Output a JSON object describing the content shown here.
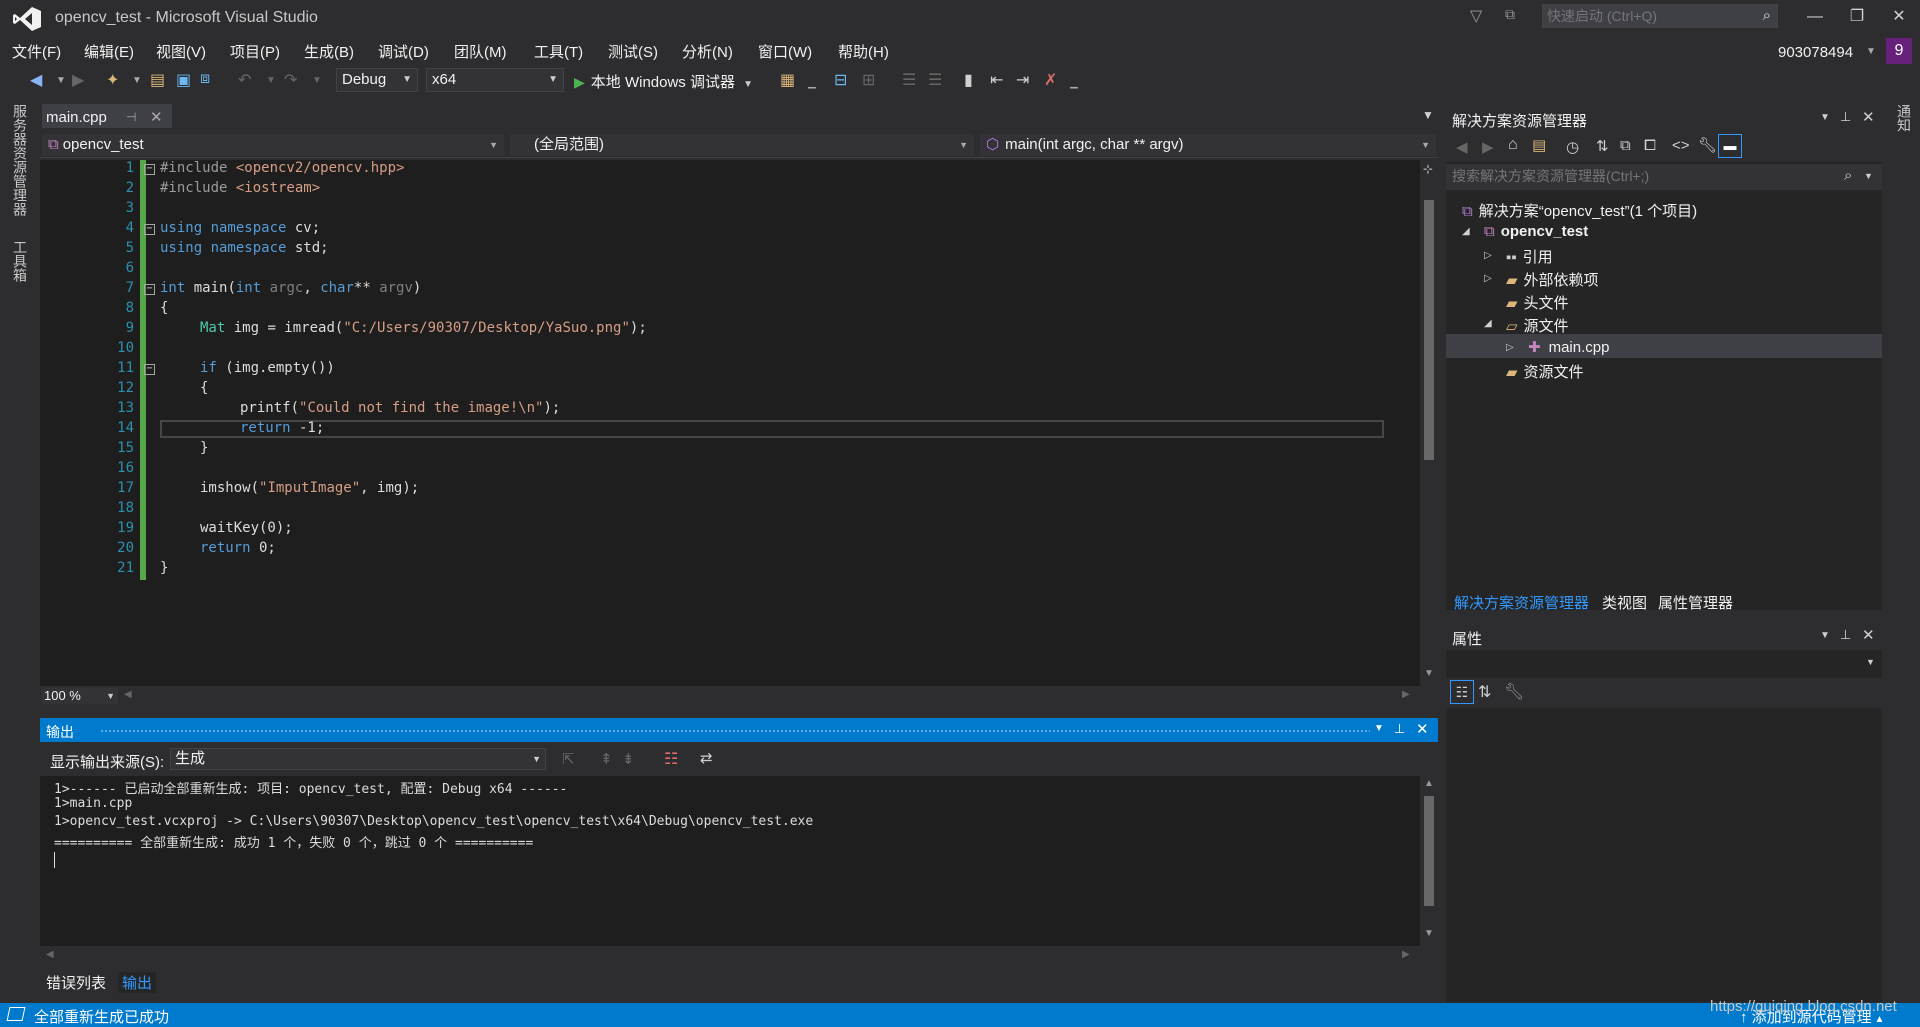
{
  "window": {
    "title": "opencv_test - Microsoft Visual Studio",
    "quick_launch_placeholder": "快速启动 (Ctrl+Q)",
    "min_glyph": "—",
    "max_glyph": "❐",
    "close_glyph": "✕"
  },
  "menu": [
    "文件(F)",
    "编辑(E)",
    "视图(V)",
    "项目(P)",
    "生成(B)",
    "调试(D)",
    "团队(M)",
    "工具(T)",
    "测试(S)",
    "分析(N)",
    "窗口(W)",
    "帮助(H)"
  ],
  "account": {
    "id": "903078494",
    "badge": "9"
  },
  "toolbar": {
    "config": "Debug",
    "platform": "x64",
    "run_label": "本地 Windows 调试器"
  },
  "side_tabs": {
    "left_1": "服务器资源管理器",
    "left_2": "工具箱",
    "right_1": "通知"
  },
  "editor": {
    "tab_label": "main.cpp",
    "nav_project": "opencv_test",
    "nav_scope": "(全局范围)",
    "nav_member": "main(int argc, char ** argv)",
    "zoom": "100 %",
    "line_numbers": [
      "1",
      "2",
      "3",
      "4",
      "5",
      "6",
      "7",
      "8",
      "9",
      "10",
      "11",
      "12",
      "13",
      "14",
      "15",
      "16",
      "17",
      "18",
      "19",
      "20",
      "21"
    ],
    "code": {
      "l1_pp": "#include ",
      "l1_inc": "<opencv2/opencv.hpp>",
      "l2_pp": "#include ",
      "l2_inc": "<iostream>",
      "l4_kw": "using namespace",
      "l4_rest": " cv;",
      "l5_kw": "using namespace",
      "l5_rest": " std;",
      "l7_kw1": "int",
      "l7_fn": " main(",
      "l7_kw2": "int",
      "l7_pa1": " argc",
      "l7_c": ", ",
      "l7_kw3": "char",
      "l7_st": "** ",
      "l7_pa2": "argv",
      "l7_end": ")",
      "l8": "{",
      "l9_ty": "Mat",
      "l9_mid": " img = imread(",
      "l9_str": "\"C:/Users/90307/Desktop/YaSuo.png\"",
      "l9_end": ");",
      "l11_kw": "if",
      "l11_rest": " (img.empty())",
      "l12": "{",
      "l13_fn": "printf(",
      "l13_str": "\"Could not find the image!\\n\"",
      "l13_end": ");",
      "l14_kw": "return",
      "l14_rest": " -1;",
      "l15": "}",
      "l17_fn": "imshow(",
      "l17_str": "\"ImputImage\"",
      "l17_end": ", img);",
      "l19": "waitKey(0);",
      "l20_kw": "return",
      "l20_rest": " 0;",
      "l21": "}"
    }
  },
  "output": {
    "title": "输出",
    "source_label": "显示输出来源(S):",
    "source_value": "生成",
    "lines": [
      "1>------ 已启动全部重新生成: 项目: opencv_test, 配置: Debug x64 ------",
      "1>main.cpp",
      "1>opencv_test.vcxproj -> C:\\Users\\90307\\Desktop\\opencv_test\\opencv_test\\x64\\Debug\\opencv_test.exe",
      "========== 全部重新生成: 成功 1 个，失败 0 个，跳过 0 个 =========="
    ]
  },
  "bottom_tabs": [
    "错误列表",
    "输出"
  ],
  "solution_explorer": {
    "title": "解决方案资源管理器",
    "search_placeholder": "搜索解决方案资源管理器(Ctrl+;)",
    "solution": "解决方案“opencv_test”(1 个项目)",
    "project": "opencv_test",
    "items": [
      "引用",
      "外部依赖项",
      "头文件",
      "源文件",
      "main.cpp",
      "资源文件"
    ],
    "tabs": [
      "解决方案资源管理器",
      "类视图",
      "属性管理器"
    ]
  },
  "properties": {
    "title": "属性"
  },
  "status": {
    "text": "全部重新生成已成功",
    "right": "添加到源代码管理",
    "watermark": "https://guiqing.blog.csdn.net"
  },
  "colors": {
    "accent": "#007acc",
    "badge": "#68217a",
    "change_bar": "#57a64a"
  }
}
